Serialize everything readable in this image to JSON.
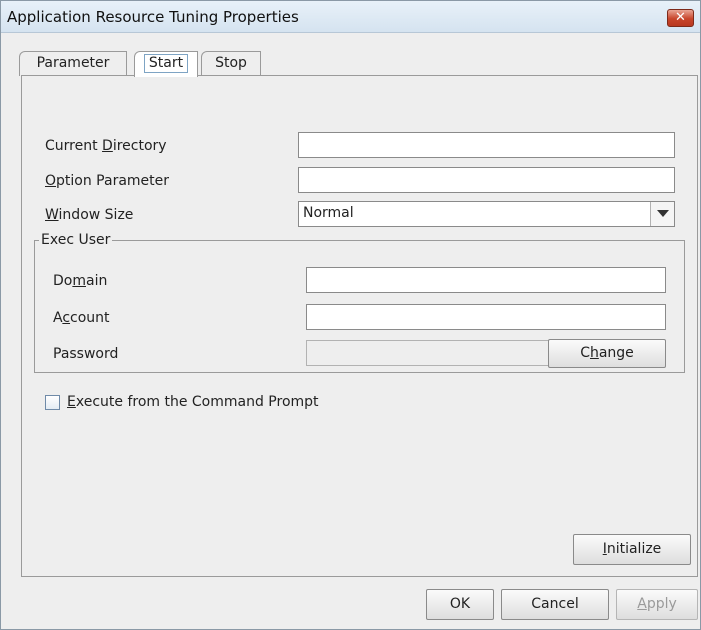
{
  "window": {
    "title": "Application Resource Tuning Properties",
    "close_glyph": "✕"
  },
  "tabs": [
    {
      "label": "Parameter",
      "active": false
    },
    {
      "label": "Start",
      "active": true
    },
    {
      "label": "Stop",
      "active": false
    }
  ],
  "form": {
    "current_directory": {
      "label_pre": "Current ",
      "label_key": "D",
      "label_post": "irectory",
      "value": ""
    },
    "option_parameter": {
      "label_pre": "",
      "label_key": "O",
      "label_post": "ption Parameter",
      "value": ""
    },
    "window_size": {
      "label_pre": "",
      "label_key": "W",
      "label_post": "indow Size",
      "value": "Normal"
    }
  },
  "exec_user": {
    "group_title": "Exec User",
    "domain": {
      "label_pre": "Do",
      "label_key": "m",
      "label_post": "ain",
      "value": ""
    },
    "account": {
      "label_pre": "A",
      "label_key": "c",
      "label_post": "count",
      "value": ""
    },
    "password": {
      "label": "Password",
      "value": ""
    },
    "change_button": {
      "label_pre": "C",
      "label_key": "h",
      "label_post": "ange"
    }
  },
  "execute_from_prompt": {
    "checked": false,
    "label_pre": "",
    "label_key": "E",
    "label_post": "xecute from the Command Prompt"
  },
  "initialize_button": {
    "label_pre": "",
    "label_key": "I",
    "label_post": "nitialize"
  },
  "footer": {
    "ok_label": "OK",
    "cancel_label": "Cancel",
    "apply_label_pre": "",
    "apply_label_key": "A",
    "apply_label_post": "pply",
    "apply_enabled": false
  },
  "icons": {
    "close": "close-icon",
    "dropdown": "chevron-down-icon"
  },
  "colors": {
    "close_button": "#c8452b",
    "active_tab_focus": "#7ea4c4"
  }
}
